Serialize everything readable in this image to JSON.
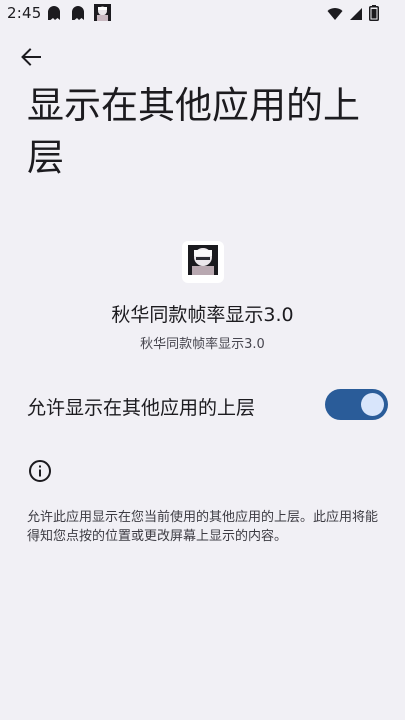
{
  "status_bar": {
    "time": "2:45",
    "left_icons": [
      "notification-ghost-icon",
      "notification-ghost-icon",
      "app-thumbnail-icon"
    ],
    "right_icons": [
      "wifi-icon",
      "signal-icon",
      "battery-icon"
    ]
  },
  "header": {
    "back_icon": "arrow-back-icon",
    "title": "显示在其他应用的上层"
  },
  "app": {
    "name": "秋华同款帧率显示3.0",
    "subname": "秋华同款帧率显示3.0",
    "icon": "app-avatar-icon"
  },
  "permission": {
    "label": "允许显示在其他应用的上层",
    "enabled": true
  },
  "info": {
    "icon": "info-icon",
    "description": "允许此应用显示在您当前使用的其他应用的上层。此应用将能得知您点按的位置或更改屏幕上显示的内容。"
  },
  "colors": {
    "background": "#f1f0f5",
    "switch_track_on": "#2a5c99",
    "switch_thumb_on": "#d8e5fb"
  }
}
